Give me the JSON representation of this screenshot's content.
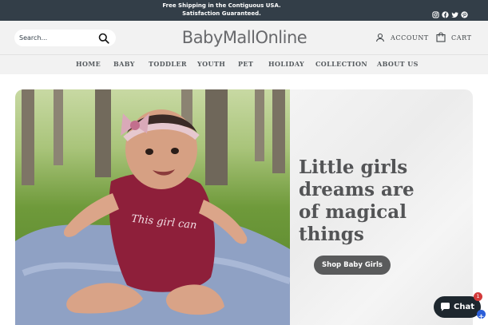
{
  "announcement": {
    "line1": "Free Shipping in the Contiguous USA.",
    "line2": "Satisfaction Guaranteed."
  },
  "social_icons": [
    "instagram-icon",
    "facebook-icon",
    "twitter-icon",
    "pinterest-icon"
  ],
  "header": {
    "search_placeholder": "Search...",
    "logo": "BabyMallOnline",
    "account_label": "ACCOUNT",
    "cart_label": "CART"
  },
  "nav": {
    "items": [
      "HOME",
      "BABY",
      "TODDLER",
      "YOUTH",
      "PET",
      "HOLIDAY",
      "COLLECTION",
      "ABOUT US"
    ]
  },
  "hero": {
    "headline_lines": [
      "Little girls",
      "dreams are",
      "of magical",
      "things"
    ],
    "onesie_text": "This girl can",
    "button_label": "Shop Baby Girls"
  },
  "chat": {
    "label": "Chat",
    "badge": "1"
  },
  "colors": {
    "announce_bg": "#333e48",
    "header_bg": "#f2f2f2",
    "button_bg": "#5a5b5c",
    "chat_bg": "#1e272e"
  }
}
